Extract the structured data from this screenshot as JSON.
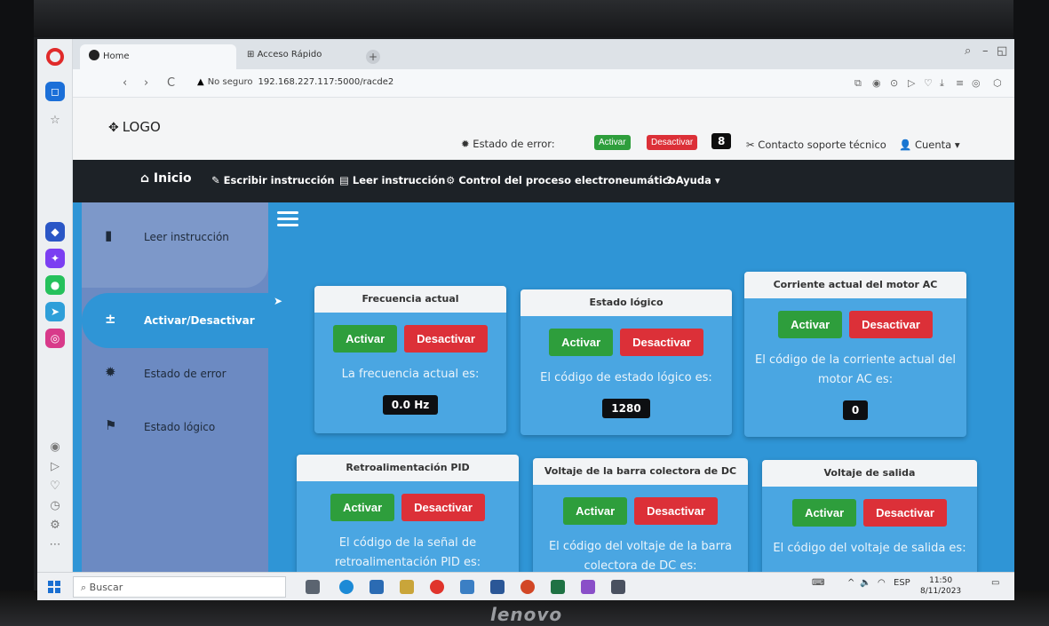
{
  "browser": {
    "tabs": [
      {
        "label": "Home"
      },
      {
        "label": "Acceso Rápido"
      }
    ],
    "address": {
      "security_label": "No seguro",
      "url": "192.168.227.117:5000/racde2"
    }
  },
  "header": {
    "logo": "LOGO",
    "error_state_label": "Estado de error:",
    "activate_label": "Activar",
    "deactivate_label": "Desactivar",
    "error_count": "8",
    "support_label": "Contacto soporte técnico",
    "account_label": "Cuenta"
  },
  "mainnav": {
    "home": "Inicio",
    "write": "Escribir instrucción",
    "read": "Leer instrucción",
    "control": "Control del proceso electroneumático",
    "help": "Ayuda"
  },
  "sidebar": {
    "items": [
      {
        "label": "Leer instrucción"
      },
      {
        "label": "Activar/Desactivar"
      },
      {
        "label": "Estado de error"
      },
      {
        "label": "Estado lógico"
      }
    ]
  },
  "cards": [
    {
      "title": "Frecuencia actual",
      "activate": "Activar",
      "deactivate": "Desactivar",
      "text": "La frecuencia actual es:",
      "value": "0.0 Hz"
    },
    {
      "title": "Estado lógico",
      "activate": "Activar",
      "deactivate": "Desactivar",
      "text": "El código de estado lógico es:",
      "value": "1280"
    },
    {
      "title": "Corriente actual del motor AC",
      "activate": "Activar",
      "deactivate": "Desactivar",
      "text": "El código de la corriente actual del motor AC es:",
      "value": "0"
    },
    {
      "title": "Retroalimentación PID",
      "activate": "Activar",
      "deactivate": "Desactivar",
      "text": "El código de la señal de retroalimentación PID es:"
    },
    {
      "title": "Voltaje de la barra colectora de DC",
      "activate": "Activar",
      "deactivate": "Desactivar",
      "text": "El código del voltaje de la barra colectora de DC es:"
    },
    {
      "title": "Voltaje de salida",
      "activate": "Activar",
      "deactivate": "Desactivar",
      "text": "El código del voltaje de salida es:"
    }
  ],
  "taskbar": {
    "search_placeholder": "Buscar",
    "lang": "ESP",
    "time": "11:50",
    "date": "8/11/2023"
  },
  "laptop_brand": "lenovo",
  "colors": {
    "page_bg": "#2f95d6",
    "card_bg": "#4aa6e2",
    "activate": "#2e9e3c",
    "deactivate": "#dc3038",
    "nav_dark": "#1d2227",
    "sidebar": "#6c8ac2"
  }
}
